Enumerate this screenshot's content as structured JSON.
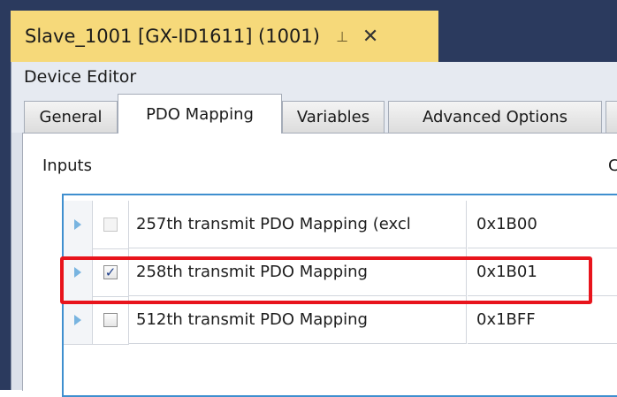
{
  "document_tab": {
    "title": "Slave_1001 [GX-ID1611] (1001)",
    "pin_icon": "pin-icon",
    "close_icon": "close-icon",
    "close_glyph": "✕",
    "pin_glyph": "⊣"
  },
  "editor": {
    "title": "Device Editor"
  },
  "tabs": [
    {
      "label": "General",
      "active": false
    },
    {
      "label": "PDO Mapping",
      "active": true
    },
    {
      "label": "Variables",
      "active": false
    },
    {
      "label": "Advanced Options",
      "active": false
    }
  ],
  "inputs_section": {
    "label": "Inputs",
    "outputs_label_partial": "C"
  },
  "pdo_rows": [
    {
      "name": "257th transmit PDO Mapping (excl",
      "index": "0x1B00",
      "checked": false,
      "enabled": false
    },
    {
      "name": "258th transmit PDO Mapping",
      "index": "0x1B01",
      "checked": true,
      "enabled": true
    },
    {
      "name": "512th transmit PDO Mapping",
      "index": "0x1BFF",
      "checked": false,
      "enabled": true
    }
  ],
  "colors": {
    "doc_tab_active": "#f6d97a",
    "title_bar": "#2b3a5e",
    "grid_border": "#3f8fcf",
    "highlight": "#e8141c"
  }
}
